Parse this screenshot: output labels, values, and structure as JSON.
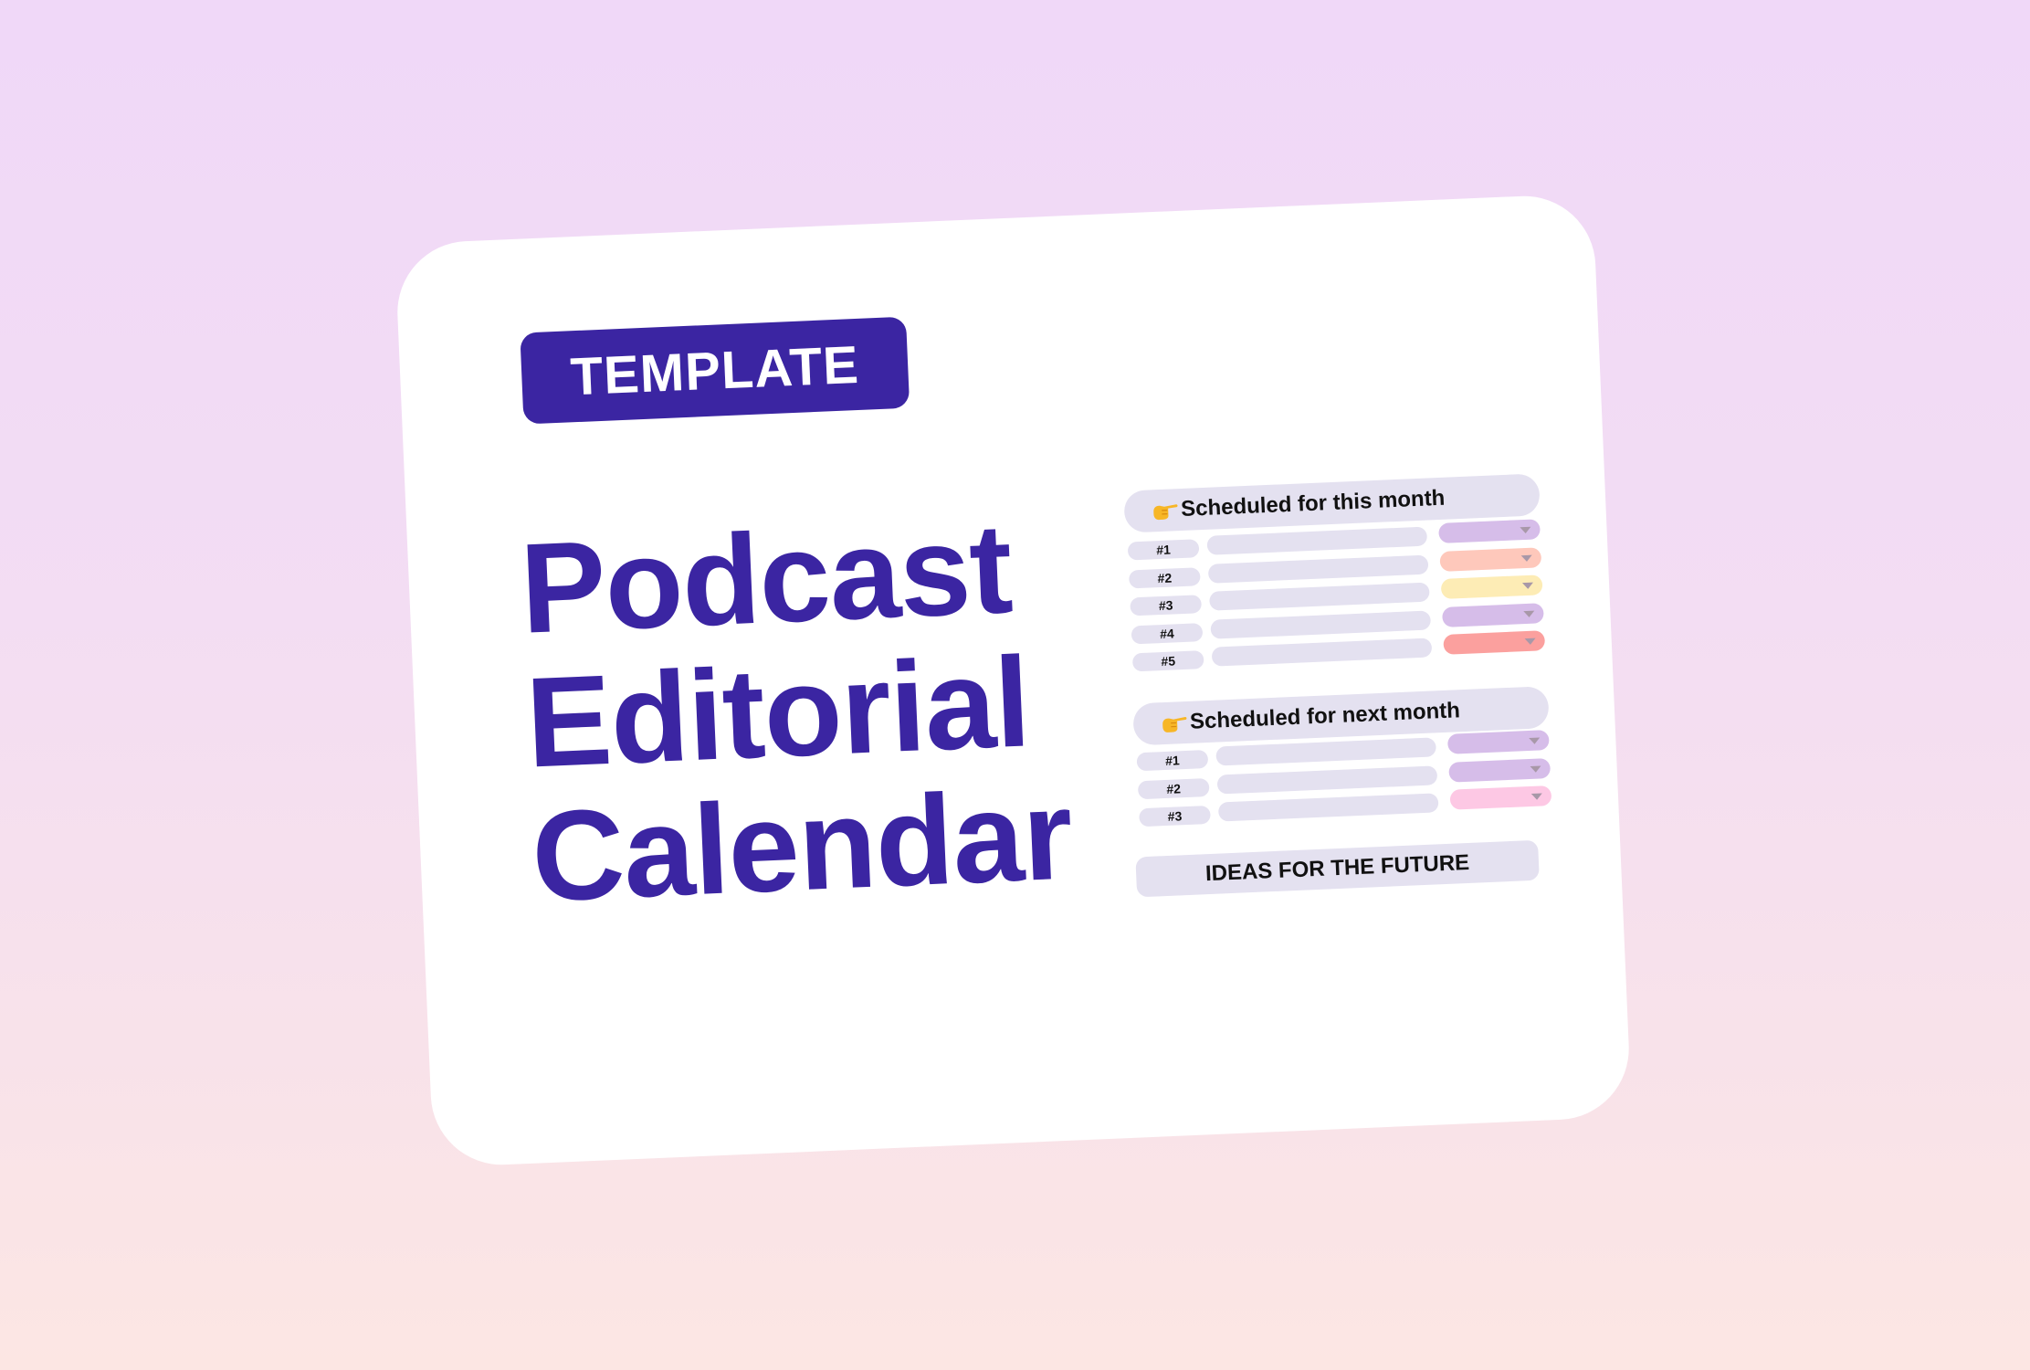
{
  "badge": {
    "label": "TEMPLATE"
  },
  "title": {
    "lines": [
      "Podcast",
      "Editorial",
      "Calendar"
    ]
  },
  "colors": {
    "brand": "#3b25a2",
    "pill_gray": "#e4e1f0",
    "dropdown_arrow": "#a898a8",
    "background_top": "#f0d8f8",
    "background_bottom": "#fce6e3"
  },
  "this_month": {
    "icon": "pointing-hand-icon",
    "header": "Scheduled for this month",
    "rows": [
      {
        "number": "#1",
        "status_color": "#d6bde9"
      },
      {
        "number": "#2",
        "status_color": "#fec8bb"
      },
      {
        "number": "#3",
        "status_color": "#fdecb5"
      },
      {
        "number": "#4",
        "status_color": "#d6bde9"
      },
      {
        "number": "#5",
        "status_color": "#fba09e"
      }
    ]
  },
  "next_month": {
    "icon": "pointing-hand-icon",
    "header": "Scheduled for next month",
    "rows": [
      {
        "number": "#1",
        "status_color": "#d6bde9"
      },
      {
        "number": "#2",
        "status_color": "#d6bde9"
      },
      {
        "number": "#3",
        "status_color": "#fdc8e4"
      }
    ]
  },
  "ideas": {
    "label": "IDEAS FOR THE FUTURE"
  }
}
